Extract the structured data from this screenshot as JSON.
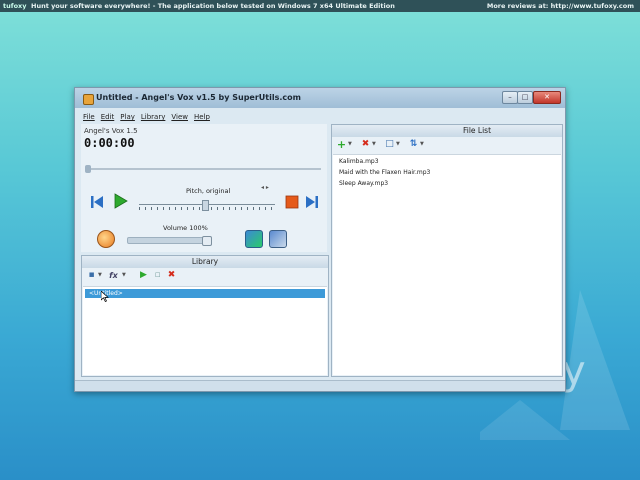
{
  "topbar": {
    "logo": "tufoxy",
    "message": "Hunt your software everywhere!  -  The application below tested on Windows 7 x64 Ultimate Edition",
    "reviews": "More reviews at: http://www.tufoxy.com"
  },
  "window": {
    "title": "Untitled - Angel's Vox v1.5 by SuperUtils.com",
    "min": "–",
    "max": "□",
    "close": "✕"
  },
  "menu": [
    "File",
    "Edit",
    "Play",
    "Library",
    "View",
    "Help"
  ],
  "player": {
    "version": "Angel's Vox 1.5",
    "time": "0:00:00",
    "pitch_label": "Pitch, original",
    "volume_label": "Volume 100%",
    "volume": 1.0
  },
  "library": {
    "title": "Library",
    "items": [
      "<Untitled>"
    ]
  },
  "filelist": {
    "title": "File List",
    "files": [
      "Kalimba.mp3",
      "Maid with the Flaxen Hair.mp3",
      "Sleep Away.mp3"
    ]
  },
  "decor": {
    "letter": "y"
  },
  "colors": {
    "accent": "#3d9ad8",
    "play": "#2eaa2e",
    "stop": "#e55a1a",
    "delete": "#d52c1c"
  }
}
